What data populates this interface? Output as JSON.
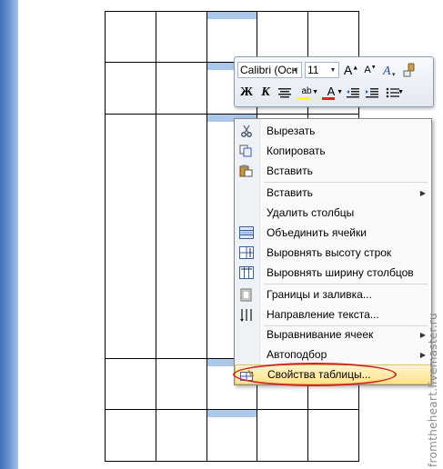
{
  "mini_toolbar": {
    "font_name": "Calibri (Осн",
    "font_size": "11",
    "bold_label": "Ж",
    "italic_label": "К",
    "highlight_label": "ab",
    "font_color_label": "A",
    "grow_font_label": "A",
    "shrink_font_label": "A"
  },
  "context_menu": {
    "items": [
      {
        "label": "Вырезать",
        "icon": "scissors-icon",
        "submenu": false
      },
      {
        "label": "Копировать",
        "icon": "copy-icon",
        "submenu": false
      },
      {
        "label": "Вставить",
        "icon": "paste-icon",
        "submenu": false
      },
      {
        "label": "Вставить",
        "icon": "",
        "submenu": true
      },
      {
        "label": "Удалить столбцы",
        "icon": "",
        "submenu": false
      },
      {
        "label": "Объединить ячейки",
        "icon": "merge-cells-icon",
        "submenu": false
      },
      {
        "label": "Выровнять высоту строк",
        "icon": "distribute-rows-icon",
        "submenu": false
      },
      {
        "label": "Выровнять ширину столбцов",
        "icon": "distribute-columns-icon",
        "submenu": false
      },
      {
        "label": "Границы и заливка...",
        "icon": "borders-shading-icon",
        "submenu": false
      },
      {
        "label": "Направление текста...",
        "icon": "text-direction-icon",
        "submenu": false
      },
      {
        "label": "Выравнивание ячеек",
        "icon": "",
        "submenu": true
      },
      {
        "label": "Автоподбор",
        "icon": "",
        "submenu": true
      },
      {
        "label": "Свойства таблицы...",
        "icon": "table-properties-icon",
        "submenu": false,
        "highlighted": true
      }
    ]
  },
  "watermark": "fromtheheart.livemaster.ru",
  "colors": {
    "selection": "#a9c8ea",
    "highlight_oval": "#d0261f",
    "menu_highlight": "#ffe38a"
  }
}
